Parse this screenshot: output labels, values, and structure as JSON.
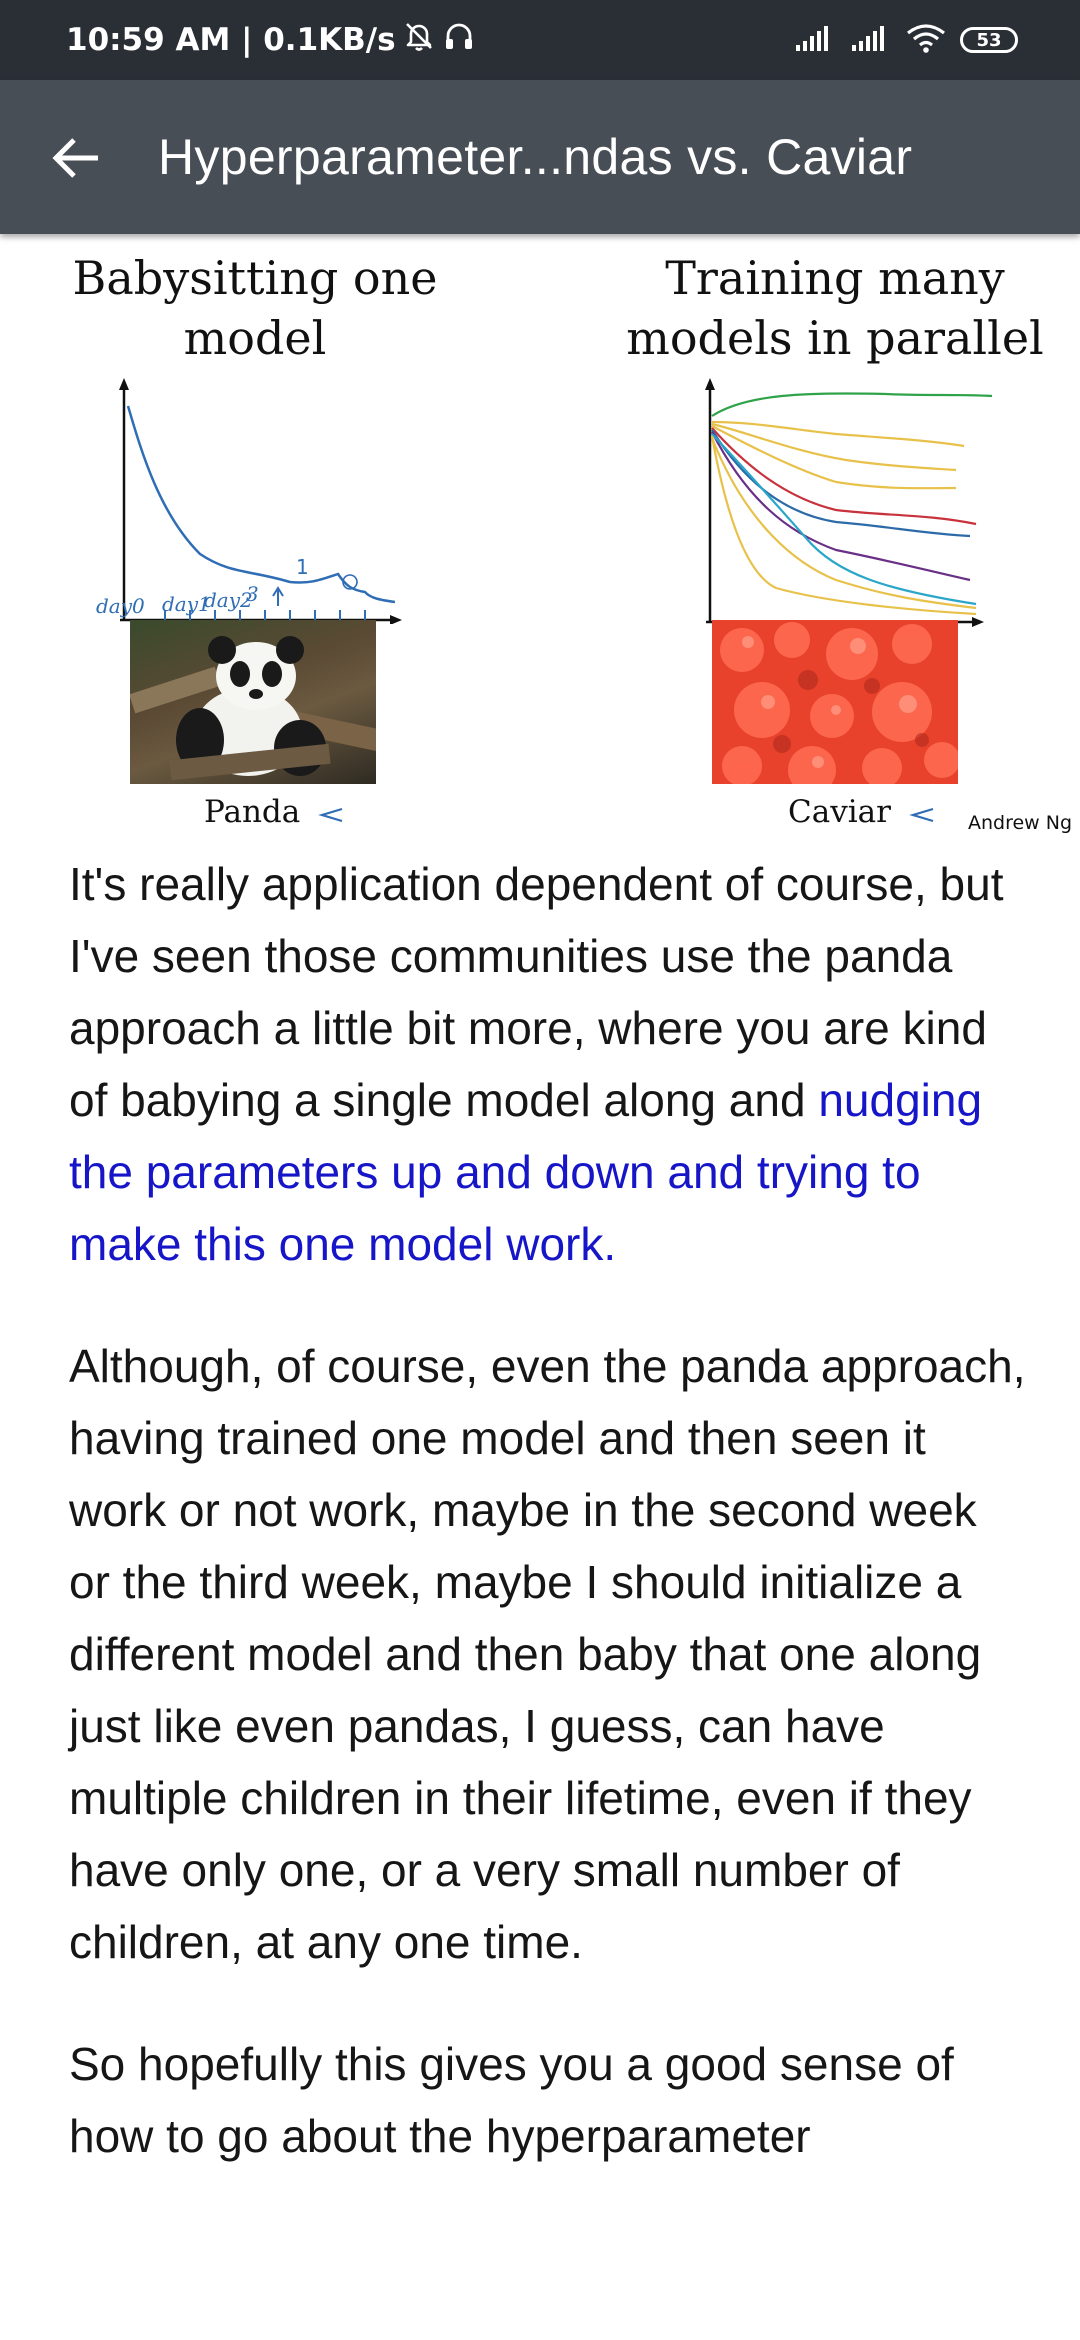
{
  "status_bar": {
    "time": "10:59 AM",
    "network_speed": "0.1KB/s",
    "battery_level": "53",
    "icons": [
      "alarm-off-icon",
      "headphones-icon",
      "signal-icon",
      "signal-icon",
      "wifi-icon",
      "battery-icon"
    ]
  },
  "app_bar": {
    "back_icon": "arrow-left-icon",
    "title": "Hyperparameter...ndas vs. Caviar"
  },
  "slide": {
    "left_heading_line1": "Babysitting one",
    "left_heading_line2": "model",
    "right_heading_line1": "Training many",
    "right_heading_line2": "models in parallel",
    "left_caption": "Panda",
    "right_caption": "Caviar",
    "credit": "Andrew Ng",
    "annotations": {
      "peak_mark": "1",
      "day_labels": [
        "day0",
        "day1",
        "day2",
        "3"
      ]
    },
    "colors": {
      "ink": "#2f6db5",
      "curves": [
        "#2fa34a",
        "#e8c14a",
        "#e8c14a",
        "#e8c14a",
        "#c8323c",
        "#2c6aa8",
        "#6a2f86",
        "#2aa6c8",
        "#e8c14a",
        "#e8c14a"
      ]
    }
  },
  "transcript": {
    "p1_before": "It's really application dependent of course, but I've seen those communities use the panda approach a little bit more, where you are kind of babying a single model along and ",
    "p1_highlight": "nudging the parameters up and down and trying to make this one model work.",
    "p2": "Although, of course, even the panda approach, having trained one model and then seen it work or not work, maybe in the second week or the third week, maybe I should initialize a different model and then baby that one along just like even pandas, I guess, can have multiple children in their lifetime, even if they have only one, or a very small number of children, at any one time.",
    "p3": "So hopefully this gives you a good sense of how to go about the hyperparameter",
    "highlight_color": "#1616c8"
  }
}
